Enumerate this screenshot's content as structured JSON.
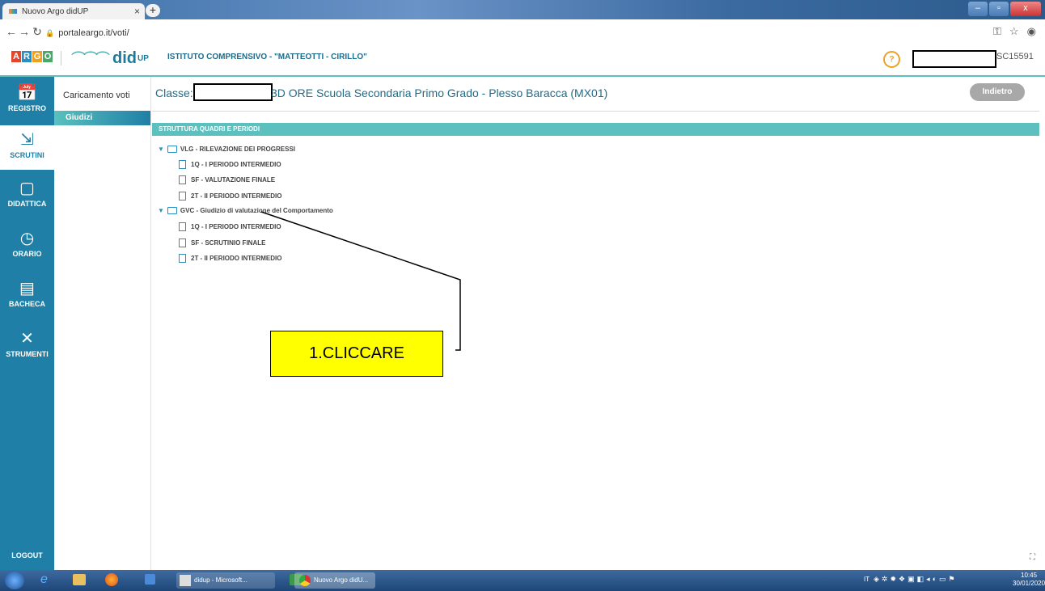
{
  "browser": {
    "tab_title": "Nuovo Argo didUP",
    "tab_close": "×",
    "new_tab": "+",
    "url": "portaleargo.it/voti/",
    "window_controls": [
      "–",
      "▫",
      "x"
    ]
  },
  "header": {
    "argo_letters": [
      "A",
      "R",
      "G",
      "O"
    ],
    "argo_colors": [
      "#e4462c",
      "#2a8fc0",
      "#f0a020",
      "#4aa868"
    ],
    "brand": "did",
    "brand_sup": "UP",
    "school": "ISTITUTO COMPRENSIVO - \"MATTEOTTI - CIRILLO\"",
    "help": "?",
    "user_code": "SC15591"
  },
  "leftnav": {
    "items": [
      {
        "label": "REGISTRO",
        "icon": "calendar-icon"
      },
      {
        "label": "SCRUTINI",
        "icon": "scrutini-icon"
      },
      {
        "label": "DIDATTICA",
        "icon": "book-icon"
      },
      {
        "label": "ORARIO",
        "icon": "clock-icon"
      },
      {
        "label": "BACHECA",
        "icon": "board-icon"
      },
      {
        "label": "STRUMENTI",
        "icon": "tools-icon"
      }
    ],
    "logout": "LOGOUT"
  },
  "subnav": {
    "items": [
      "Caricamento voti",
      "Giudizi"
    ],
    "active": "Giudizi"
  },
  "main": {
    "classe_label": "Classe:",
    "classe_rest": "3D ORE Scuola Secondaria Primo Grado - Plesso Baracca (MX01)",
    "back_button": "Indietro",
    "section_title": "STRUTTURA QUADRI E PERIODI",
    "tree": [
      {
        "label": "VLG - RILEVAZIONE DEI PROGRESSI",
        "children": [
          "1Q - I PERIODO INTERMEDIO",
          "SF - VALUTAZIONE FINALE",
          "2T - II PERIODO INTERMEDIO"
        ]
      },
      {
        "label": "GVC - Giudizio di valutazione del Comportamento",
        "children": [
          "1Q - I PERIODO INTERMEDIO",
          "SF - SCRUTINIO FINALE",
          "2T - II PERIODO INTERMEDIO"
        ]
      }
    ]
  },
  "annotation": {
    "callout": "1.CLICCARE"
  },
  "taskbar": {
    "items": [
      "didup - Microsoft...",
      "Nuovo Argo didU..."
    ],
    "lang": "IT",
    "time": "10:45",
    "date": "30/01/2020"
  }
}
